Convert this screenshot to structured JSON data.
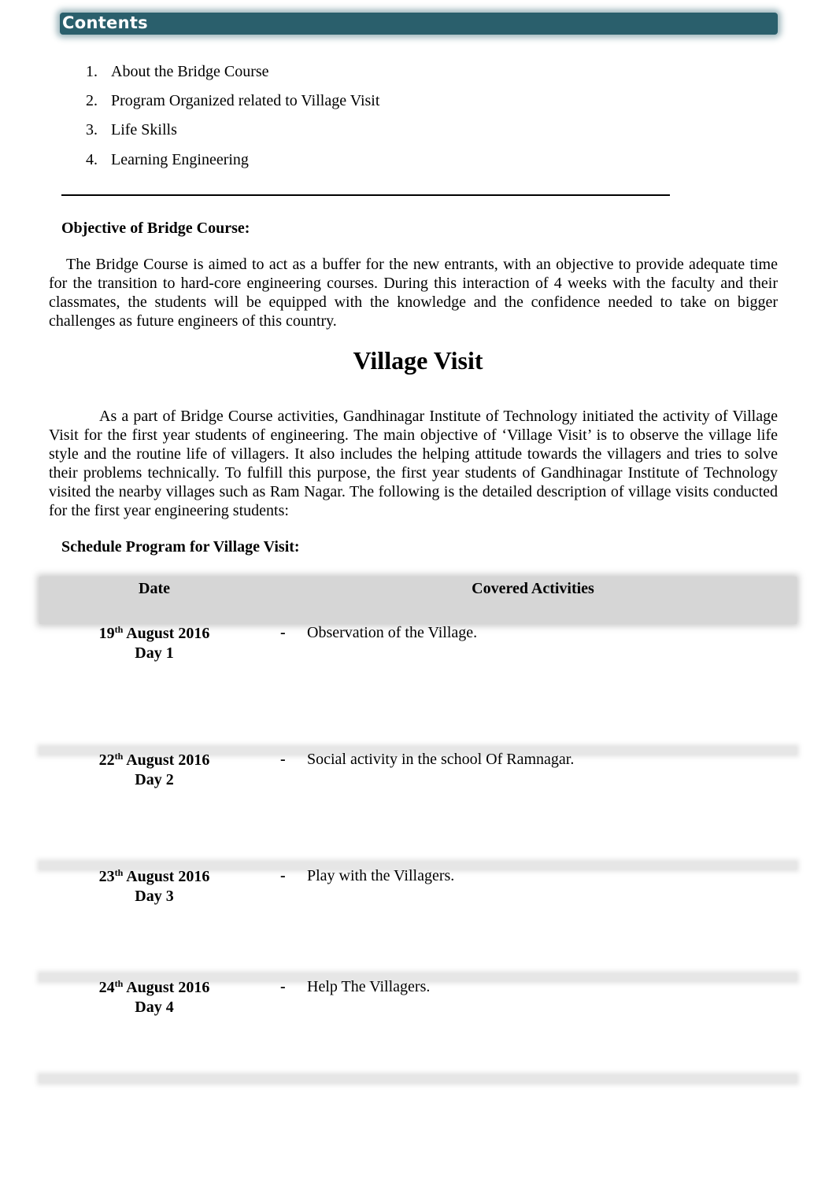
{
  "contents": {
    "title": "Contents",
    "items": [
      {
        "num": "1.",
        "label": "About the Bridge Course"
      },
      {
        "num": "2.",
        "label": "Program Organized related to Village Visit"
      },
      {
        "num": "3.",
        "label": "Life Skills"
      },
      {
        "num": "4.",
        "label": "Learning Engineering"
      }
    ]
  },
  "objective": {
    "heading": "Objective of Bridge Course:",
    "text": "The Bridge Course is aimed to act as a buffer for the new entrants, with an objective to provide adequate time for the transition to hard-core engineering courses. During this interaction of 4 weeks with the faculty and their classmates, the students will be equipped with the knowledge and the confidence needed to take on bigger challenges as future engineers of this country."
  },
  "village_visit": {
    "title": "Village Visit",
    "text": "As a part of Bridge Course activities, Gandhinagar Institute of Technology initiated the activity of Village Visit for the first year students of engineering. The main objective of ‘Village Visit’ is to observe the village life style and the routine life of villagers. It also includes the helping attitude towards the villagers and tries to solve their problems technically. To fulfill this purpose, the first year students of Gandhinagar Institute of Technology visited the nearby villages such as Ram Nagar. The following is the detailed description of village visits conducted for the first year engineering students:"
  },
  "schedule": {
    "heading": "Schedule Program for Village Visit:",
    "columns": [
      "Date",
      "Covered Activities"
    ],
    "rows": [
      {
        "day_num": "19",
        "suffix": "th",
        "date_rest": " August 2016",
        "day": "Day 1",
        "bullet": "-",
        "activity": "Observation of the Village."
      },
      {
        "day_num": "22",
        "suffix": "th",
        "date_rest": " August 2016",
        "day": "Day 2",
        "bullet": "-",
        "activity": "Social activity in the school Of Ramnagar."
      },
      {
        "day_num": "23",
        "suffix": "th",
        "date_rest": " August 2016",
        "day": "Day 3",
        "bullet": "-",
        "activity": "Play with the Villagers."
      },
      {
        "day_num": "24",
        "suffix": "th",
        "date_rest": " August 2016",
        "day": "Day 4",
        "bullet": "-",
        "activity": "Help The Villagers."
      }
    ]
  }
}
